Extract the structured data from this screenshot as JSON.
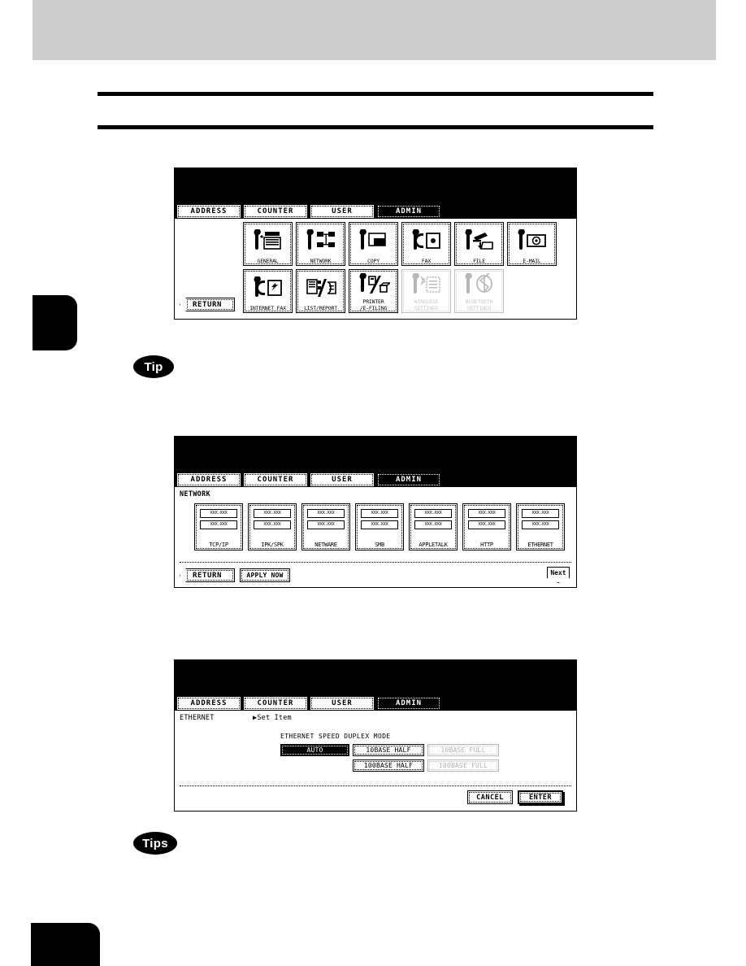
{
  "page": {
    "header_band": "",
    "chapter_tab": "",
    "footer_tab": ""
  },
  "tips": {
    "tip_single": "Tip",
    "tip_plural": "Tips"
  },
  "tabs": {
    "address": "ADDRESS",
    "counter": "COUNTER",
    "user": "USER",
    "admin": "ADMIN"
  },
  "panel1": {
    "return_label": "RETURN",
    "buttons": [
      {
        "label": "GENERAL",
        "icon": "wrench-copier-icon",
        "state": "enabled"
      },
      {
        "label": "NETWORK",
        "icon": "wrench-network-icon",
        "state": "enabled"
      },
      {
        "label": "COPY",
        "icon": "wrench-copy-icon",
        "state": "enabled"
      },
      {
        "label": "FAX",
        "icon": "wrench-fax-icon",
        "state": "enabled"
      },
      {
        "label": "FILE",
        "icon": "wrench-file-icon",
        "state": "enabled"
      },
      {
        "label": "E-MAIL",
        "icon": "wrench-email-icon",
        "state": "enabled"
      },
      {
        "label": "INTERNET FAX",
        "icon": "wrench-internetfax-icon",
        "state": "enabled"
      },
      {
        "label": "LIST/REPORT",
        "icon": "list-report-icon",
        "state": "enabled"
      },
      {
        "label": "PRINTER\n/E-FILING",
        "icon": "wrench-printer-efiling-icon",
        "state": "enabled"
      },
      {
        "label": "WIRELESS\nSETTINGS",
        "icon": "wrench-wireless-icon",
        "state": "disabled"
      },
      {
        "label": "BLUETOOTH\nSETTINGS",
        "icon": "wrench-bluetooth-icon",
        "state": "disabled"
      }
    ]
  },
  "panel2": {
    "section": "NETWORK",
    "placeholder_row_1": "XXX.XXX",
    "placeholder_row_2": "XXX.XXX",
    "items": [
      {
        "label": "TCP/IP"
      },
      {
        "label": "IPK/SPK"
      },
      {
        "label": "NETWARE"
      },
      {
        "label": "SMB"
      },
      {
        "label": "APPLETALK"
      },
      {
        "label": "HTTP"
      },
      {
        "label": "ETHERNET"
      }
    ],
    "return_label": "RETURN",
    "apply_label": "APPLY NOW",
    "next_label": "Next"
  },
  "panel3": {
    "section": "ETHERNET",
    "set_item": "▶Set Item",
    "duplex_title": "ETHERNET SPEED DUPLEX MODE",
    "options": [
      {
        "label": "AUTO",
        "state": "selected"
      },
      {
        "label": "10BASE HALF",
        "state": "enabled"
      },
      {
        "label": "10BASE FULL",
        "state": "disabled"
      },
      {
        "label": "100BASE HALF",
        "state": "enabled"
      },
      {
        "label": "100BASE FULL",
        "state": "disabled"
      }
    ],
    "cancel_label": "CANCEL",
    "enter_label": "ENTER"
  }
}
